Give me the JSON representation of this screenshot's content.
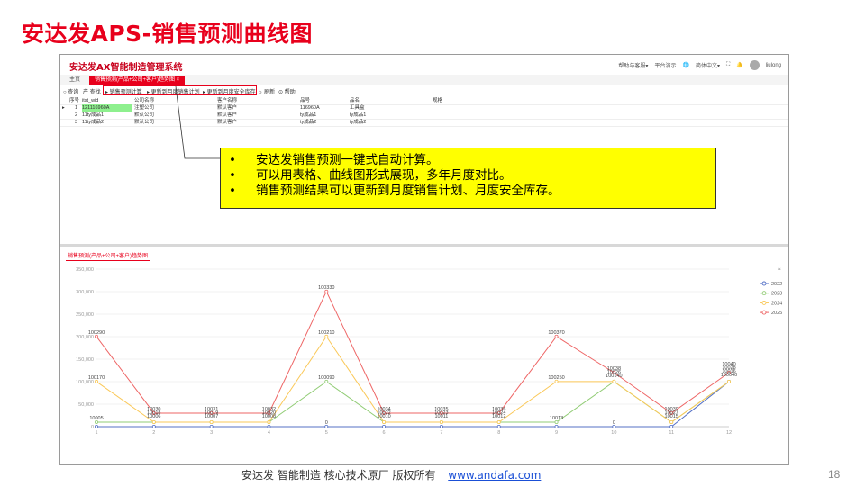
{
  "slide_title": "安达发APS-销售预测曲线图",
  "app": {
    "name": "安达发AX智能制造管理系统",
    "topbar": {
      "help": "帮助与客服▾",
      "platform": "平台演示",
      "lang": "简体中文▾",
      "user": "liulong"
    }
  },
  "tabs": [
    {
      "label": "主页"
    },
    {
      "label": "销售预测(产品+公司+客户)趋势图  ×"
    }
  ],
  "toolbar": {
    "query": "○ 查询",
    "product": "产 查找",
    "calc": "▸ 销售预测计算",
    "to_plan": "▸ 更新到月度销售计划",
    "to_safety": "▸ 更新到月度安全库存",
    "refresh": "☼ 刷新",
    "help": "⊙ 帮助"
  },
  "table": {
    "headers": [
      "序号",
      "itst_wid",
      "公司名称",
      "客户名称",
      "品号",
      "品名",
      "规格"
    ],
    "rows": [
      [
        "1",
        "121116960A",
        "注塑公司",
        "默认客户",
        "116960A",
        "工具盒",
        ""
      ],
      [
        "2",
        "11ty成品1",
        "默认公司",
        "默认客户",
        "ty成品1",
        "ty成品1",
        ""
      ],
      [
        "3",
        "11ty成品2",
        "默认公司",
        "默认客户",
        "ty成品2",
        "ty成品2",
        ""
      ]
    ]
  },
  "callout": [
    "安达发销售预测一键式自动计算。",
    "可以用表格、曲线图形式展现，多年月度对比。",
    "销售预测结果可以更新到月度销售计划、月度安全库存。"
  ],
  "chart_tab": "销售预测(产品+公司+客户)趋势图",
  "chart_data": {
    "type": "line",
    "x": [
      1,
      2,
      3,
      4,
      5,
      6,
      7,
      8,
      9,
      10,
      11,
      12
    ],
    "ylim": [
      0,
      350000
    ],
    "yticks": [
      "350,000",
      "300,000",
      "250,000",
      "200,000",
      "150,000",
      "100,000",
      "50,000",
      "0"
    ],
    "ytick_values": [
      350000,
      300000,
      250000,
      200000,
      150000,
      100000,
      50000,
      0
    ],
    "legend_position": "right",
    "series": [
      {
        "name": "2022",
        "color": "#5470c6",
        "values": [
          5,
          6,
          7,
          8,
          0,
          10,
          11,
          12,
          13,
          0,
          15,
          100040
        ]
      },
      {
        "name": "2023",
        "color": "#91cc75",
        "values": [
          10005,
          10006,
          10007,
          10008,
          100090,
          10010,
          10011,
          10012,
          10013,
          100140,
          10015,
          100016
        ]
      },
      {
        "name": "2024",
        "color": "#fac858",
        "values": [
          100170,
          10018,
          10019,
          10020,
          200210,
          10022,
          10023,
          10024,
          100250,
          100260,
          10027,
          100028
        ]
      },
      {
        "name": "2025",
        "color": "#ee6666",
        "values": [
          200290,
          30030,
          30031,
          30032,
          300330,
          30034,
          30035,
          30036,
          200370,
          120038,
          30039,
          120040
        ]
      }
    ],
    "data_labels": [
      {
        "x": 1,
        "text": "10005",
        "y": 10005
      },
      {
        "x": 1,
        "text": "100170",
        "y": 100170
      },
      {
        "x": 1,
        "text": "100290",
        "y": 200290
      },
      {
        "x": 2,
        "text": "10030",
        "y": 30030
      },
      {
        "x": 2,
        "text": "10018",
        "y": 22000
      },
      {
        "x": 2,
        "text": "10006",
        "y": 14000
      },
      {
        "x": 3,
        "text": "10031",
        "y": 30031
      },
      {
        "x": 3,
        "text": "10019",
        "y": 22000
      },
      {
        "x": 3,
        "text": "10007",
        "y": 14000
      },
      {
        "x": 4,
        "text": "10032",
        "y": 30032
      },
      {
        "x": 4,
        "text": "10020",
        "y": 22000
      },
      {
        "x": 4,
        "text": "10008",
        "y": 14000
      },
      {
        "x": 5,
        "text": "100330",
        "y": 300330
      },
      {
        "x": 5,
        "text": "100210",
        "y": 200210
      },
      {
        "x": 5,
        "text": "100090",
        "y": 100090
      },
      {
        "x": 5,
        "text": "0",
        "y": 0
      },
      {
        "x": 6,
        "text": "10034",
        "y": 30034
      },
      {
        "x": 6,
        "text": "10022",
        "y": 22000
      },
      {
        "x": 6,
        "text": "10010",
        "y": 14000
      },
      {
        "x": 7,
        "text": "10035",
        "y": 30035
      },
      {
        "x": 7,
        "text": "10023",
        "y": 22000
      },
      {
        "x": 7,
        "text": "10011",
        "y": 14000
      },
      {
        "x": 8,
        "text": "10036",
        "y": 30036
      },
      {
        "x": 8,
        "text": "10024",
        "y": 22000
      },
      {
        "x": 8,
        "text": "10012",
        "y": 14000
      },
      {
        "x": 9,
        "text": "100370",
        "y": 200370
      },
      {
        "x": 9,
        "text": "100250",
        "y": 100250
      },
      {
        "x": 9,
        "text": "10013",
        "y": 10013
      },
      {
        "x": 10,
        "text": "10038",
        "y": 120038
      },
      {
        "x": 10,
        "text": "10026",
        "y": 112000
      },
      {
        "x": 10,
        "text": "100140",
        "y": 104000
      },
      {
        "x": 10,
        "text": "0",
        "y": 0
      },
      {
        "x": 11,
        "text": "10039",
        "y": 30039
      },
      {
        "x": 11,
        "text": "10027",
        "y": 22000
      },
      {
        "x": 11,
        "text": "10015",
        "y": 14000
      },
      {
        "x": 12,
        "text": "10040",
        "y": 130000
      },
      {
        "x": 12,
        "text": "10028",
        "y": 122000
      },
      {
        "x": 12,
        "text": "10016",
        "y": 114000
      },
      {
        "x": 12,
        "text": "100040",
        "y": 106000
      }
    ]
  },
  "footer": {
    "text": "安达发   智能制造 核心技术原厂   版权所有",
    "link": "www.andafa.com"
  },
  "page_number": "18"
}
